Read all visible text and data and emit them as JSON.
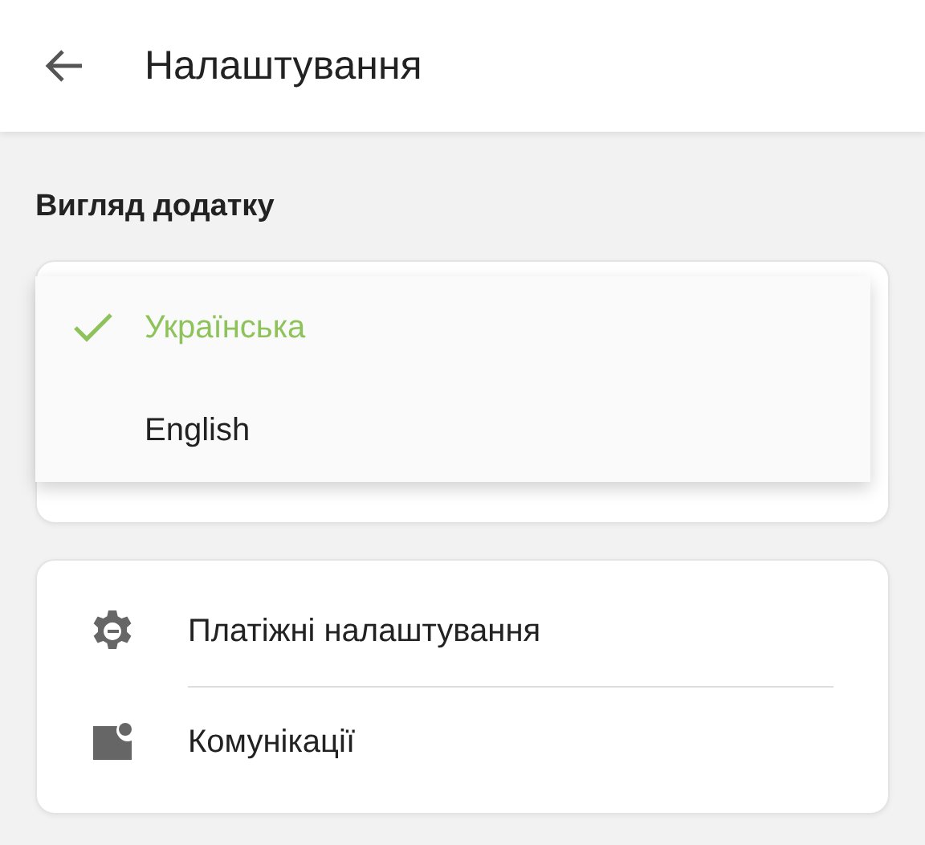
{
  "header": {
    "title": "Налаштування"
  },
  "section_title": "Вигляд додатку",
  "language_menu": [
    {
      "label": "Українська",
      "selected": true
    },
    {
      "label": "English",
      "selected": false
    }
  ],
  "settings_items": [
    {
      "label": "Платіжні налаштування"
    },
    {
      "label": "Комунікації"
    }
  ]
}
